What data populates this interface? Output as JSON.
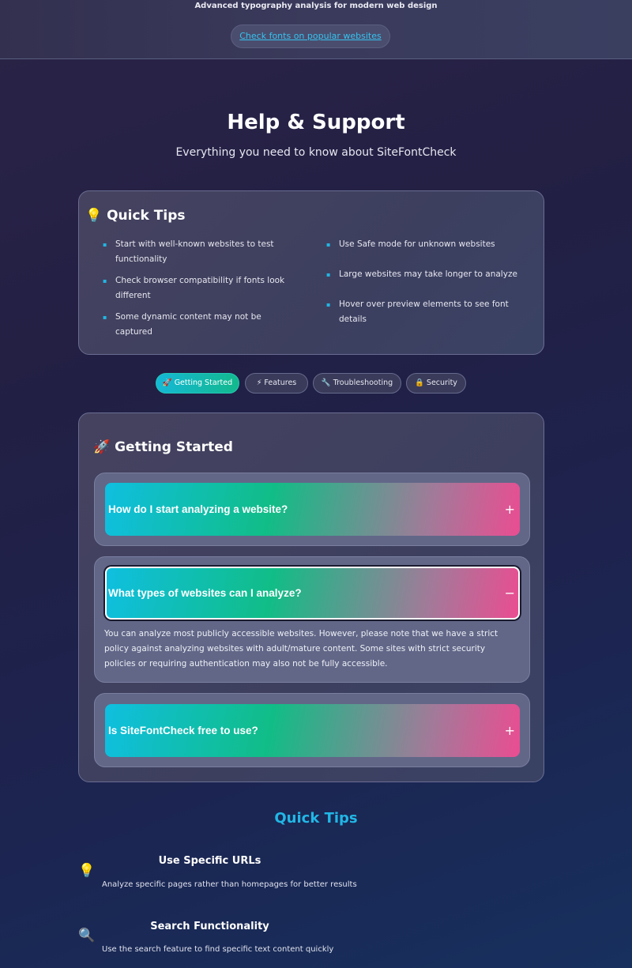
{
  "header": {
    "subtitle": "Advanced typography analysis for modern web design",
    "check_link": "Check fonts on popular websites"
  },
  "page": {
    "title": "Help & Support",
    "subtitle": "Everything you need to know about SiteFontCheck"
  },
  "quick_tips_panel": {
    "title": "💡 Quick Tips",
    "left_items": [
      "Start with well-known websites to test functionality",
      "Check browser compatibility if fonts look different",
      "Some dynamic content may not be captured"
    ],
    "right_items": [
      "Use Safe mode for unknown websites",
      "Large websites may take longer to analyze",
      "Hover over preview elements to see font details"
    ]
  },
  "tabs": [
    {
      "label": "🚀 Getting Started",
      "active": true
    },
    {
      "label": "⚡ Features",
      "active": false
    },
    {
      "label": "🔧 Troubleshooting",
      "active": false
    },
    {
      "label": "🔒 Security",
      "active": false
    }
  ],
  "faq": {
    "title": "🚀 Getting Started",
    "items": [
      {
        "question": "How do I start analyzing a website?",
        "toggle": "+",
        "open": false
      },
      {
        "question": "What types of websites can I analyze?",
        "toggle": "−",
        "open": true,
        "answer": "You can analyze most publicly accessible websites. However, please note that we have a strict policy against analyzing websites with adult/mature content. Some sites with strict security policies or requiring authentication may also not be fully accessible."
      },
      {
        "question": "Is SiteFontCheck free to use?",
        "toggle": "+",
        "open": false
      }
    ]
  },
  "bottom_tips": {
    "title": "Quick Tips",
    "items": [
      {
        "icon": "lightbulb-icon",
        "glyph": "💡",
        "title": "Use Specific URLs",
        "desc": "Analyze specific pages rather than homepages for better results"
      },
      {
        "icon": "magnifier-icon",
        "glyph": "🔍",
        "title": "Search Functionality",
        "desc": "Use the search feature to find specific text content quickly"
      }
    ]
  },
  "colors": {
    "accent_cyan": "#21b7e6",
    "accent_green": "#11bd86",
    "accent_pink": "#ea4d92"
  }
}
